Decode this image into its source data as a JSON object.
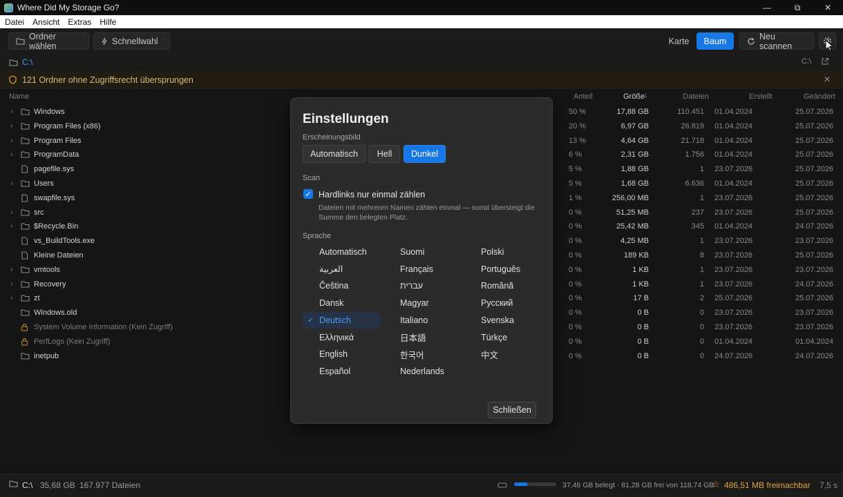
{
  "window": {
    "title": "Where Did My Storage Go?"
  },
  "menu": [
    "Datei",
    "Ansicht",
    "Extras",
    "Hilfe"
  ],
  "toolbar": {
    "choose_folder": "Ordner wählen",
    "quick": "Schnellwahl",
    "view_map": "Karte",
    "view_tree": "Baum",
    "rescan": "Neu scannen"
  },
  "path": {
    "current": "C:\\",
    "drive": "C:\\"
  },
  "warning": {
    "text": "121 Ordner ohne Zugriffsrecht übersprungen"
  },
  "columns": {
    "name": "Name",
    "share": "Anteil",
    "size": "Größe",
    "files": "Dateien",
    "created": "Erstellt",
    "modified": "Geändert"
  },
  "rows": [
    {
      "name": "Windows",
      "kind": "folder",
      "expand": true,
      "share": "50 %",
      "share_value": 50,
      "size": "17,88 GB",
      "files": "110.451",
      "created": "01.04.2024",
      "modified": "25.07.2026"
    },
    {
      "name": "Program Files (x86)",
      "kind": "folder",
      "expand": true,
      "share": "20 %",
      "share_value": 20,
      "size": "6,97 GB",
      "files": "26.819",
      "created": "01.04.2024",
      "modified": "25.07.2026"
    },
    {
      "name": "Program Files",
      "kind": "folder",
      "expand": true,
      "share": "13 %",
      "share_value": 13,
      "size": "4,64 GB",
      "files": "21.718",
      "created": "01.04.2024",
      "modified": "25.07.2026"
    },
    {
      "name": "ProgramData",
      "kind": "folder",
      "expand": true,
      "share": "6 %",
      "share_value": 6,
      "size": "2,31 GB",
      "files": "1.756",
      "created": "01.04.2024",
      "modified": "25.07.2026"
    },
    {
      "name": "pagefile.sys",
      "kind": "file",
      "expand": false,
      "share": "5 %",
      "share_value": 5,
      "size": "1,88 GB",
      "files": "1",
      "created": "23.07.2026",
      "modified": "25.07.2026"
    },
    {
      "name": "Users",
      "kind": "folder",
      "expand": true,
      "share": "5 %",
      "share_value": 5,
      "size": "1,68 GB",
      "files": "6.636",
      "created": "01.04.2024",
      "modified": "25.07.2026"
    },
    {
      "name": "swapfile.sys",
      "kind": "file",
      "expand": false,
      "share": "1 %",
      "share_value": 1,
      "size": "256,00 MB",
      "files": "1",
      "created": "23.07.2026",
      "modified": "25.07.2026"
    },
    {
      "name": "src",
      "kind": "folder",
      "expand": true,
      "share": "0 %",
      "share_value": 0,
      "size": "51,25 MB",
      "files": "237",
      "created": "23.07.2026",
      "modified": "25.07.2026"
    },
    {
      "name": "$Recycle.Bin",
      "kind": "folder",
      "expand": true,
      "share": "0 %",
      "share_value": 0,
      "size": "25,42 MB",
      "files": "345",
      "created": "01.04.2024",
      "modified": "24.07.2026"
    },
    {
      "name": "vs_BuildTools.exe",
      "kind": "file",
      "expand": false,
      "share": "0 %",
      "share_value": 0,
      "size": "4,25 MB",
      "files": "1",
      "created": "23.07.2026",
      "modified": "23.07.2026"
    },
    {
      "name": "Kleine Dateien",
      "kind": "file",
      "expand": false,
      "share": "0 %",
      "share_value": 0,
      "size": "189 KB",
      "files": "8",
      "created": "23.07.2026",
      "modified": "25.07.2026"
    },
    {
      "name": "vmtools",
      "kind": "folder",
      "expand": true,
      "share": "0 %",
      "share_value": 0,
      "size": "1 KB",
      "files": "1",
      "created": "23.07.2026",
      "modified": "23.07.2026"
    },
    {
      "name": "Recovery",
      "kind": "folder",
      "expand": true,
      "share": "0 %",
      "share_value": 0,
      "size": "1 KB",
      "files": "1",
      "created": "23.07.2026",
      "modified": "24.07.2026"
    },
    {
      "name": "zt",
      "kind": "folder",
      "expand": true,
      "share": "0 %",
      "share_value": 0,
      "size": "17 B",
      "files": "2",
      "created": "25.07.2026",
      "modified": "25.07.2026"
    },
    {
      "name": "Windows.old",
      "kind": "folder",
      "expand": false,
      "share": "0 %",
      "share_value": 0,
      "size": "0 B",
      "files": "0",
      "created": "23.07.2026",
      "modified": "23.07.2026"
    },
    {
      "name": "System Volume Information  (Kein Zugriff)",
      "kind": "locked",
      "expand": false,
      "share": "0 %",
      "share_value": 0,
      "size": "0 B",
      "files": "0",
      "created": "23.07.2026",
      "modified": "23.07.2026"
    },
    {
      "name": "PerfLogs  (Kein Zugriff)",
      "kind": "locked",
      "expand": false,
      "share": "0 %",
      "share_value": 0,
      "size": "0 B",
      "files": "0",
      "created": "01.04.2024",
      "modified": "01.04.2024"
    },
    {
      "name": "inetpub",
      "kind": "folder",
      "expand": false,
      "share": "0 %",
      "share_value": 0,
      "size": "0 B",
      "files": "0",
      "created": "24.07.2026",
      "modified": "24.07.2026"
    }
  ],
  "status": {
    "drive": "C:\\",
    "total": "35,68 GB",
    "files": "167.977 Dateien",
    "disk_text": "37,46 GB belegt · 81,28 GB frei von 118,74 GB",
    "disk_used_fraction": 0.315,
    "reclaim": "486,51 MB freimachbar",
    "time": "7,5 s"
  },
  "settings": {
    "title": "Einstellungen",
    "appearance_label": "Erscheinungsbild",
    "appearance_options": [
      "Automatisch",
      "Hell",
      "Dunkel"
    ],
    "appearance_selected": "Dunkel",
    "scan_label": "Scan",
    "hardlinks_label": "Hardlinks nur einmal zählen",
    "hardlinks_checked": true,
    "hardlinks_hint": "Dateien mit mehreren Namen zählen einmal — sonst übersteigt die Summe den belegten Platz.",
    "language_label": "Sprache",
    "languages": [
      "Automatisch",
      "العربية",
      "Čeština",
      "Dansk",
      "Deutsch",
      "Ελληνικά",
      "English",
      "Español",
      "Suomi",
      "Français",
      "עברית",
      "Magyar",
      "Italiano",
      "日本語",
      "한국어",
      "Nederlands",
      "Polski",
      "Português",
      "Română",
      "Русский",
      "Svenska",
      "Türkçe",
      "中文"
    ],
    "language_selected": "Deutsch",
    "close": "Schließen"
  },
  "colors": {
    "accent": "#1677e6",
    "warning": "#d6b873",
    "reclaim": "#e2a63b"
  }
}
